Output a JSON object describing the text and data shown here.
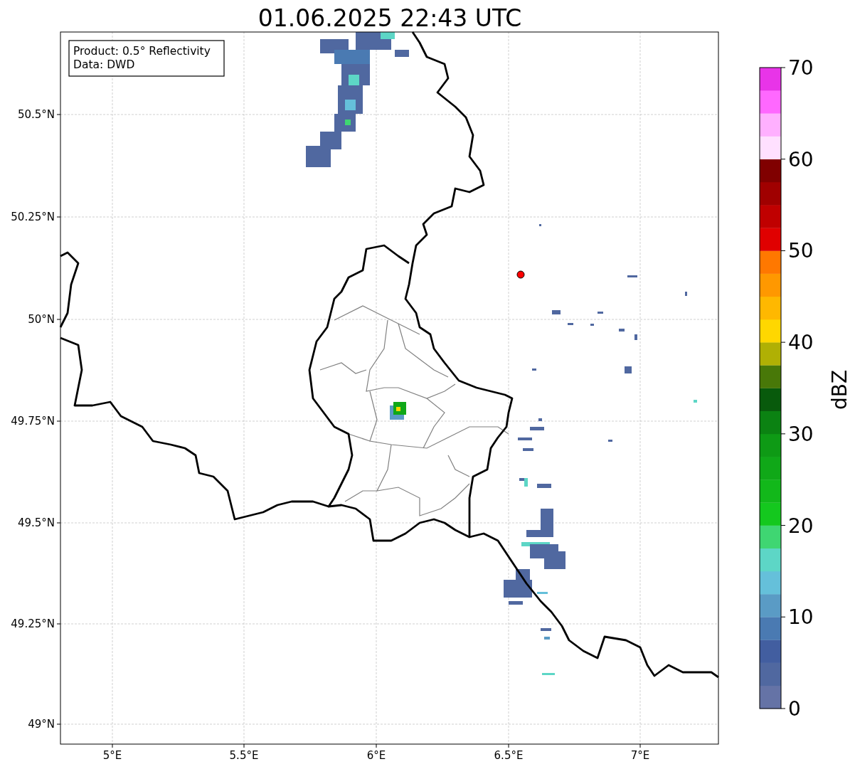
{
  "title": "01.06.2025 22:43 UTC",
  "info_box": {
    "lines": [
      "Product: 0.5° Reflectivity",
      "Data: DWD"
    ]
  },
  "map": {
    "longitude_labels": [
      "5°E",
      "5.5°E",
      "6°E",
      "6.5°E",
      "7°E"
    ],
    "latitude_labels": [
      "50.5°N",
      "50.25°N",
      "50°N",
      "49.75°N",
      "49.5°N",
      "49.25°N",
      "49°N"
    ]
  },
  "colorbar": {
    "label": "dBZ",
    "ticks": [
      "70",
      "60",
      "50",
      "40",
      "30",
      "20",
      "10",
      "0"
    ],
    "bands": [
      {
        "color": "#6573a6"
      },
      {
        "color": "#5068a0"
      },
      {
        "color": "#425ea0"
      },
      {
        "color": "#4a7ab2"
      },
      {
        "color": "#5a9bc5"
      },
      {
        "color": "#65c0da"
      },
      {
        "color": "#5dd6c6"
      },
      {
        "color": "#3fd672"
      },
      {
        "color": "#14c81e"
      },
      {
        "color": "#12b81a"
      },
      {
        "color": "#10a818"
      },
      {
        "color": "#0e9a15"
      },
      {
        "color": "#0b8212"
      },
      {
        "color": "#085a0c"
      },
      {
        "color": "#487808"
      },
      {
        "color": "#b0b004"
      },
      {
        "color": "#ffd700"
      },
      {
        "color": "#ffb800"
      },
      {
        "color": "#ff9800"
      },
      {
        "color": "#ff7800"
      },
      {
        "color": "#e00000"
      },
      {
        "color": "#c00000"
      },
      {
        "color": "#a00000"
      },
      {
        "color": "#800000"
      },
      {
        "color": "#ffe0ff"
      },
      {
        "color": "#ffb0ff"
      },
      {
        "color": "#ff68ff"
      },
      {
        "color": "#e834e8"
      }
    ]
  }
}
